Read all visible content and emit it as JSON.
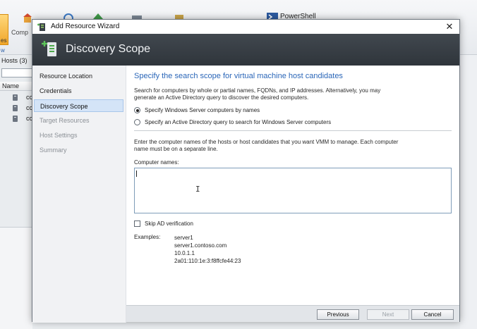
{
  "console": {
    "left_button_label": "es",
    "left_view_label": "w",
    "compute_label": "Comp",
    "powershell_label": "PowerShell",
    "hosts_header": "Hosts (3)",
    "name_column": "Name",
    "rows": [
      "cc",
      "cc",
      "cc"
    ]
  },
  "dialog": {
    "title": "Add Resource Wizard",
    "close_glyph": "✕",
    "banner_title": "Discovery Scope",
    "nav": [
      {
        "label": "Resource Location",
        "state": "normal"
      },
      {
        "label": "Credentials",
        "state": "normal"
      },
      {
        "label": "Discovery Scope",
        "state": "active"
      },
      {
        "label": "Target Resources",
        "state": "dim"
      },
      {
        "label": "Host Settings",
        "state": "dim"
      },
      {
        "label": "Summary",
        "state": "dim"
      }
    ],
    "heading": "Specify the search scope for virtual machine host candidates",
    "intro_line1": "Search for computers by whole or partial names, FQDNs, and IP addresses. Alternatively, you may",
    "intro_line2": "generate an Active Directory query to discover the desired computers.",
    "radio_by_name": "Specify Windows Server computers by names",
    "radio_ad_query": "Specify an Active Directory query to search for Windows Server computers",
    "instructions_line1": "Enter the computer names of the hosts or host candidates that you want VMM to manage. Each computer",
    "instructions_line2": "name must be on a separate line.",
    "computer_names_label": "Computer names:",
    "computer_names_value": "",
    "skip_ad_label": "Skip AD verification",
    "skip_ad_checked": false,
    "examples_label": "Examples:",
    "examples": [
      "server1",
      "server1.contoso.com",
      "10.0.1.1",
      "2a01:110:1e:3:f8ffcfe44:23"
    ],
    "buttons": {
      "previous": "Previous",
      "next": "Next",
      "cancel": "Cancel"
    }
  },
  "colors": {
    "heading": "#2a66b8",
    "banner": "#353b41",
    "nav_active": "#d4e4f7"
  }
}
